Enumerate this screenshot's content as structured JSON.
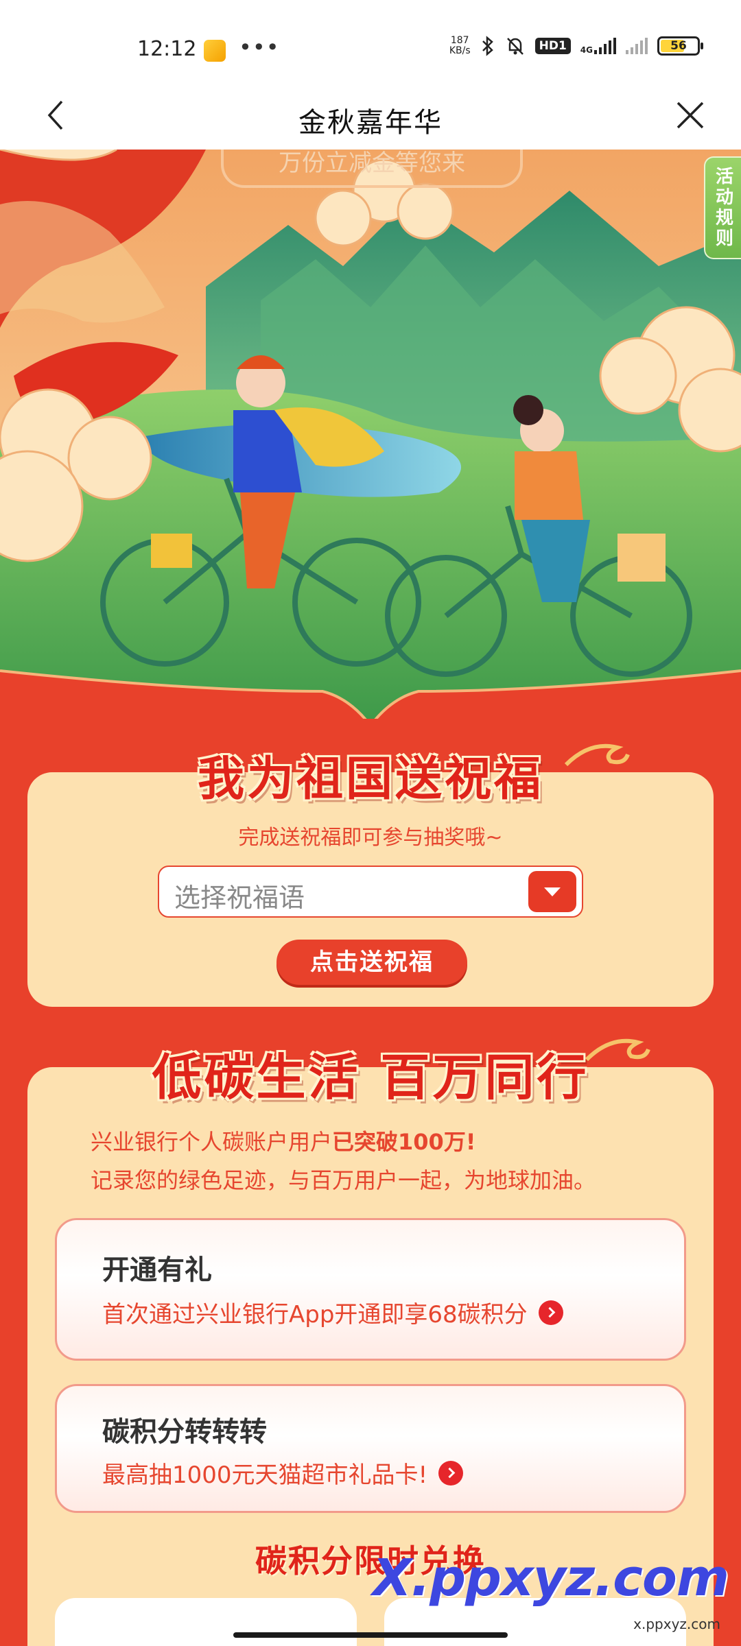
{
  "status_bar": {
    "time": "12:12",
    "speed_value": "187",
    "speed_unit": "KB/s",
    "hd": "HD1",
    "network": "4G",
    "battery": "56"
  },
  "header": {
    "title": "金秋嘉年华"
  },
  "hero": {
    "banner_text": "万份立减金等您来",
    "rules_tab": "活动规则"
  },
  "blessing": {
    "title": "我为祖国送祝福",
    "subtitle": "完成送祝福即可参与抽奖哦~",
    "select_placeholder": "选择祝福语",
    "send_button": "点击送祝福"
  },
  "lowcarbon": {
    "title": "低碳生活 百万同行",
    "intro_prefix": "兴业银行个人碳账户用户",
    "intro_bold": "已突破100万!",
    "intro_line2": "记录您的绿色足迹，与百万用户一起，为地球加油。",
    "cards": [
      {
        "title": "开通有礼",
        "desc": "首次通过兴业银行App开通即享68碳积分"
      },
      {
        "title": "碳积分转转转",
        "desc": "最高抽1000元天猫超市礼品卡!"
      }
    ],
    "exchange_title": "碳积分限时兑换"
  },
  "watermark": {
    "main": "X.ppxyz.com",
    "small": "x.ppxyz.com"
  },
  "colors": {
    "accent": "#e8412b",
    "card": "#fde1b0",
    "green_tab": "#7fc455"
  }
}
